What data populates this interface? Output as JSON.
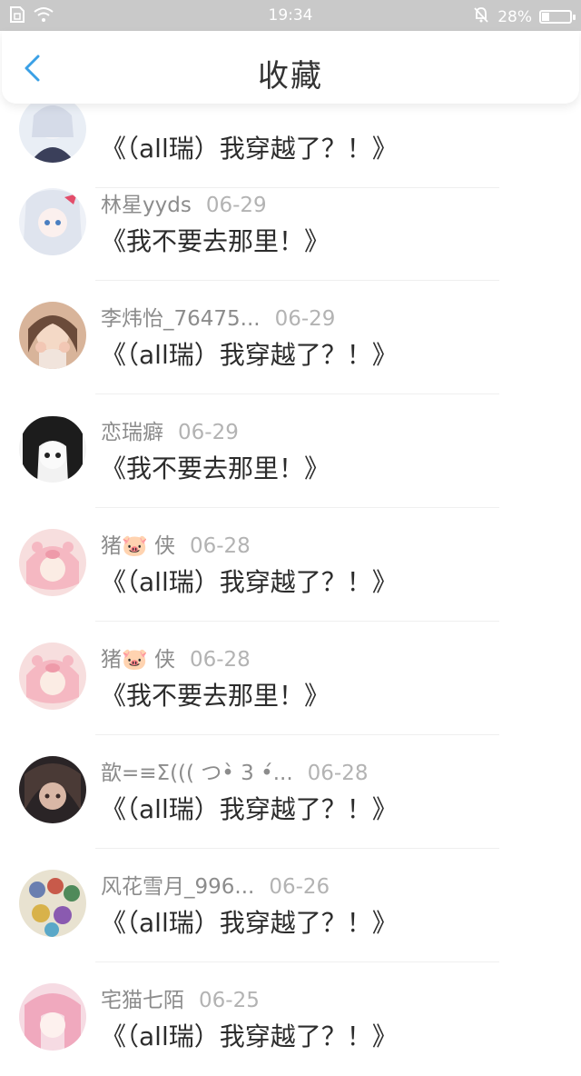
{
  "status_bar": {
    "time": "19:34",
    "battery_percent": "28%",
    "battery_level": 0.28,
    "icons": [
      "sim-icon",
      "wifi-icon",
      "mute-bell-icon",
      "battery-icon"
    ]
  },
  "header": {
    "title": "收藏",
    "back_icon": "chevron-left-icon"
  },
  "items": [
    {
      "author": "",
      "date": "",
      "title": "《（all瑞）我穿越了？！》",
      "avatar": "avatar-silver-hair"
    },
    {
      "author": "林星yyds",
      "date": "06-29",
      "title": "《我不要去那里！》",
      "avatar": "avatar-silver-hair"
    },
    {
      "author": "李炜怡_76475...",
      "date": "06-29",
      "title": "《（all瑞）我穿越了？！》",
      "avatar": "avatar-photo-girl"
    },
    {
      "author": "恋瑞癖",
      "date": "06-29",
      "title": "《我不要去那里！》",
      "avatar": "avatar-monochrome-anime"
    },
    {
      "author": "猪🐷 侠",
      "date": "06-28",
      "title": "《（all瑞）我穿越了？！》",
      "avatar": "avatar-pig-hood"
    },
    {
      "author": "猪🐷 侠",
      "date": "06-28",
      "title": "《我不要去那里！》",
      "avatar": "avatar-pig-hood"
    },
    {
      "author": "歆=≡Σ((( つ•̀ 3 •́...",
      "date": "06-28",
      "title": "《（all瑞）我穿越了？！》",
      "avatar": "avatar-dark-portrait"
    },
    {
      "author": "风花雪月_996...",
      "date": "06-26",
      "title": "《（all瑞）我穿越了？！》",
      "avatar": "avatar-group-chibi"
    },
    {
      "author": "宅猫七陌",
      "date": "06-25",
      "title": "《（all瑞）我穿越了？！》",
      "avatar": "avatar-pink-hair"
    }
  ]
}
